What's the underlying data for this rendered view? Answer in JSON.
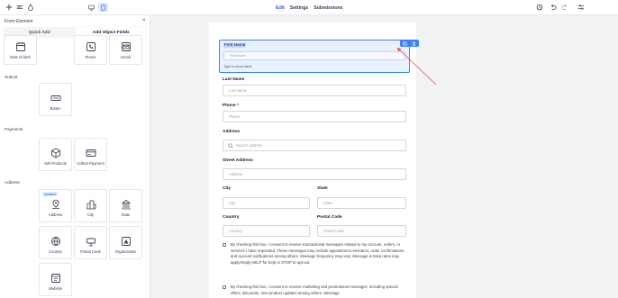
{
  "topbar": {
    "tabs": [
      {
        "label": "Edit",
        "active": true
      },
      {
        "label": "Settings",
        "active": false
      },
      {
        "label": "Submissions",
        "active": false
      }
    ]
  },
  "sidebar": {
    "title": "Form Element",
    "close": "×",
    "tabs": [
      {
        "label": "Quick Add",
        "active": false
      },
      {
        "label": "Add Object Fields",
        "active": true
      }
    ],
    "row_top": [
      {
        "label": "Date of birth",
        "icon": "calendar-icon"
      },
      {
        "label": "Phone",
        "icon": "phone-icon"
      },
      {
        "label": "Email",
        "icon": "email-icon"
      }
    ],
    "sections": {
      "submit": {
        "title": "Submit",
        "items": [
          {
            "label": "Button",
            "icon": "button-icon"
          }
        ]
      },
      "payments": {
        "title": "Payments",
        "items": [
          {
            "label": "Sell Products",
            "icon": "package-icon"
          },
          {
            "label": "Collect Payment",
            "icon": "credit-card-icon"
          }
        ]
      },
      "address": {
        "title": "Address",
        "badge": "Updated",
        "items": [
          {
            "label": "Address",
            "icon": "location-pin-icon"
          },
          {
            "label": "City",
            "icon": "city-icon"
          },
          {
            "label": "State",
            "icon": "state-building-icon"
          },
          {
            "label": "Country",
            "icon": "globe-icon"
          },
          {
            "label": "Postal Code",
            "icon": "postal-mailbox-icon"
          },
          {
            "label": "Organization",
            "icon": "organization-icon"
          },
          {
            "label": "Website",
            "icon": "website-icon"
          }
        ]
      }
    }
  },
  "form": {
    "selected": {
      "label": "First Name",
      "placeholder": "First Name",
      "help": "Type a short label"
    },
    "fields": [
      {
        "label": "Last Name",
        "placeholder": "Last Name"
      },
      {
        "label": "Phone *",
        "placeholder": "Phone"
      },
      {
        "label": "Address",
        "placeholder": "Search address"
      },
      {
        "label": "Street Address",
        "placeholder": "Address"
      },
      {
        "label": "City",
        "placeholder": "City"
      },
      {
        "label": "State",
        "placeholder": "State"
      },
      {
        "label": "Country",
        "placeholder": "Country"
      },
      {
        "label": "Postal Code",
        "placeholder": "Postal Code"
      }
    ],
    "consent_1": "By checking this box, I consent to receive transactional messages related to my account, orders, or services I have requested. These messages may include appointment reminders, order confirmations, and account notifications among others. Message frequency may vary. Message & Data rates may apply.Reply HELP for help or STOP to opt-out.",
    "consent_2": "By checking this box, I consent to receive marketing and promotional messages, including special offers, discounts, new product updates among others. Message"
  },
  "colors": {
    "accent": "#2563eb",
    "selection": "#3b82f6",
    "arrow": "#ef4444"
  }
}
